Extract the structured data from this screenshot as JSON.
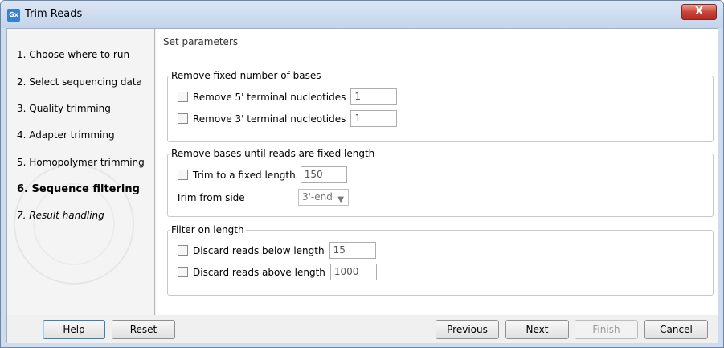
{
  "window": {
    "title": "Trim Reads",
    "icon_label": "Gx",
    "close_label": "X"
  },
  "steps": [
    {
      "label": "1.  Choose where to run",
      "state": "done"
    },
    {
      "label": "2.  Select sequencing data",
      "state": "done"
    },
    {
      "label": "3.  Quality trimming",
      "state": "done"
    },
    {
      "label": "4.  Adapter trimming",
      "state": "done"
    },
    {
      "label": "5.  Homopolymer trimming",
      "state": "done"
    },
    {
      "label": "6.  Sequence filtering",
      "state": "current"
    },
    {
      "label": "7.  Result handling",
      "state": "upcoming"
    }
  ],
  "main": {
    "section_title": "Set parameters",
    "group_fixed": {
      "legend": "Remove fixed number of bases",
      "remove5_label": "Remove 5' terminal nucleotides",
      "remove5_value": "1",
      "remove5_checked": false,
      "remove3_label": "Remove 3' terminal nucleotides",
      "remove3_value": "1",
      "remove3_checked": false
    },
    "group_length": {
      "legend": "Remove bases until reads are fixed length",
      "trim_label": "Trim to a fixed length",
      "trim_value": "150",
      "trim_checked": false,
      "side_label": "Trim from side",
      "side_value": "3'-end"
    },
    "group_filter": {
      "legend": "Filter on length",
      "below_label": "Discard reads below length",
      "below_value": "15",
      "below_checked": false,
      "above_label": "Discard reads above length",
      "above_value": "1000",
      "above_checked": false
    }
  },
  "buttons": {
    "help": "Help",
    "reset": "Reset",
    "previous": "Previous",
    "next": "Next",
    "finish": "Finish",
    "cancel": "Cancel"
  },
  "colors": {
    "title_bar": "#c3d4ea",
    "close_button": "#c8453a",
    "focus_border": "#3c7fb1"
  }
}
